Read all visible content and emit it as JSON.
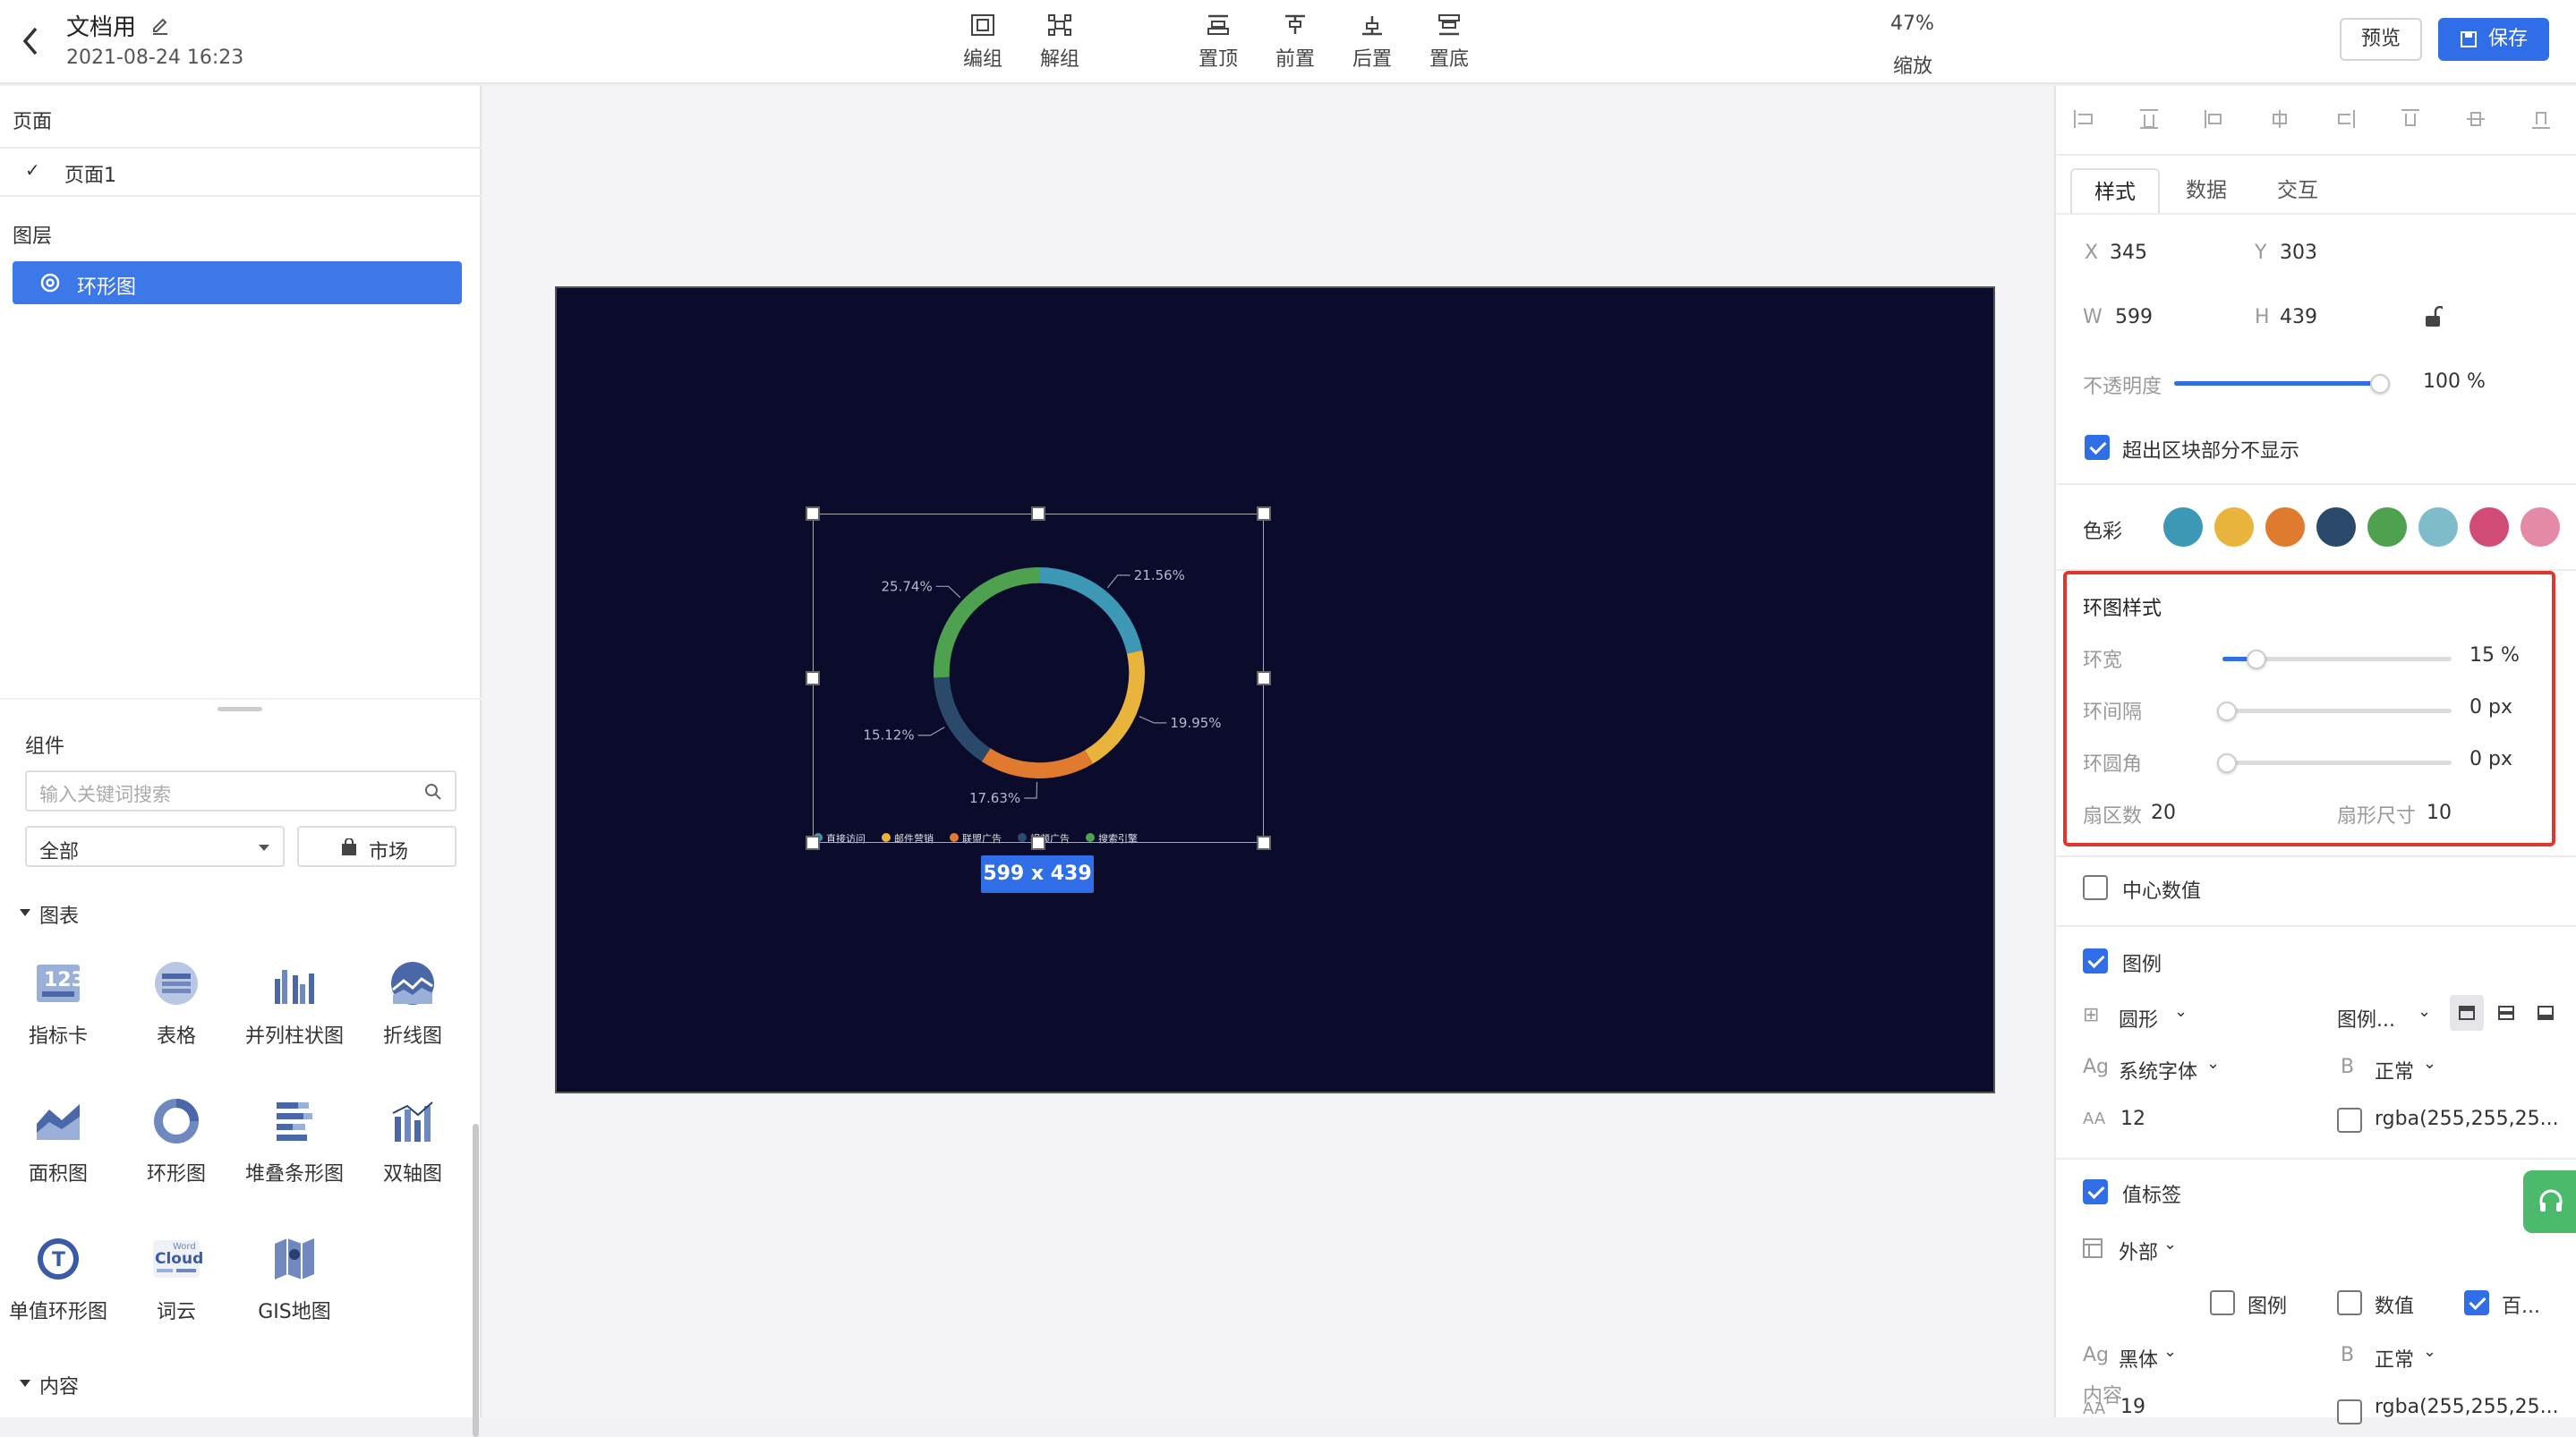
{
  "header": {
    "doc_title": "文档用",
    "timestamp": "2021-08-24 16:23",
    "tools": [
      {
        "label": "编组",
        "icon": "group-icon"
      },
      {
        "label": "解组",
        "icon": "ungroup-icon"
      },
      {
        "label": "置顶",
        "icon": "bring-to-top-icon"
      },
      {
        "label": "前置",
        "icon": "bring-forward-icon"
      },
      {
        "label": "后置",
        "icon": "send-backward-icon"
      },
      {
        "label": "置底",
        "icon": "send-to-bottom-icon"
      }
    ],
    "zoom_value": "47%",
    "zoom_label": "缩放",
    "preview_label": "预览",
    "save_label": "保存"
  },
  "left": {
    "pages_title": "页面",
    "page_item": "页面1",
    "layers_title": "图层",
    "layer_item": "环形图",
    "components_title": "组件",
    "search_placeholder": "输入关键词搜索",
    "filter_value": "全部",
    "market_label": "市场",
    "chart_group": "图表",
    "components": [
      {
        "label": "指标卡",
        "icon": "metric-card-icon"
      },
      {
        "label": "表格",
        "icon": "table-icon"
      },
      {
        "label": "并列柱状图",
        "icon": "grouped-bar-icon"
      },
      {
        "label": "折线图",
        "icon": "line-chart-icon"
      },
      {
        "label": "面积图",
        "icon": "area-chart-icon"
      },
      {
        "label": "环形图",
        "icon": "donut-chart-icon"
      },
      {
        "label": "堆叠条形图",
        "icon": "stacked-bar-icon"
      },
      {
        "label": "双轴图",
        "icon": "dual-axis-icon"
      },
      {
        "label": "单值环形图",
        "icon": "single-value-donut-icon"
      },
      {
        "label": "词云",
        "icon": "word-cloud-icon"
      },
      {
        "label": "GIS地图",
        "icon": "gis-map-icon"
      }
    ],
    "word_cloud_icon_text": {
      "small": "Word",
      "big": "Cloud"
    },
    "content_group": "内容"
  },
  "canvas": {
    "background": "#0b0b2b",
    "size_badge": "599 x 439"
  },
  "chart_data": {
    "type": "pie",
    "inner_radius_ratio": 0.85,
    "series": [
      {
        "name": "直接访问",
        "value": 21.56,
        "color": "#3d98b6"
      },
      {
        "name": "邮件营销",
        "value": 19.95,
        "color": "#e8b43c"
      },
      {
        "name": "联盟广告",
        "value": 17.63,
        "color": "#e07a2f"
      },
      {
        "name": "视频广告",
        "value": 15.12,
        "color": "#2b4a6b"
      },
      {
        "name": "搜索引擎",
        "value": 25.74,
        "color": "#4ea24f"
      }
    ],
    "value_labels": [
      "21.56%",
      "19.95%",
      "17.63%",
      "15.12%",
      "25.74%"
    ],
    "legend_position": "bottom-left"
  },
  "right": {
    "align_icons": [
      "align-left-icon",
      "align-hcenter-icon",
      "align-right-icon",
      "distribute-h-icon",
      "align-top-icon",
      "align-vcenter-icon",
      "align-bottom-icon",
      "distribute-v-icon"
    ],
    "tabs": [
      "样式",
      "数据",
      "交互"
    ],
    "x_label": "X",
    "x_value": "345",
    "y_label": "Y",
    "y_value": "303",
    "w_label": "W",
    "w_value": "599",
    "h_label": "H",
    "h_value": "439",
    "opacity_label": "不透明度",
    "opacity_value": "100 %",
    "opacity_fraction": 1.0,
    "clip_label": "超出区块部分不显示",
    "color_label": "色彩",
    "palette": [
      "#3d98b6",
      "#e8b43c",
      "#e07a2f",
      "#2b4a6b",
      "#4ea24f",
      "#7fbcca",
      "#d24a76",
      "#e58aa6"
    ],
    "ring_section_title": "环图样式",
    "ring_width_label": "环宽",
    "ring_width_value": "15 %",
    "ring_width_fraction": 0.15,
    "ring_gap_label": "环间隔",
    "ring_gap_value": "0 px",
    "ring_radius_label": "环圆角",
    "ring_radius_value": "0 px",
    "sector_count_label": "扇区数",
    "sector_count_value": "20",
    "sector_size_label": "扇形尺寸",
    "sector_size_value": "10",
    "center_value_label": "中心数值",
    "legend_label": "图例",
    "legend_shape": "圆形",
    "legend_pos": "图例...",
    "font_icon": "Ag",
    "font_family": "系统字体",
    "bold_icon": "B",
    "font_weight": "正常",
    "size_icon": "AA",
    "font_size": "12",
    "legend_color": "rgba(255,255,25...",
    "value_label_title": "值标签",
    "value_label_pos": "外部",
    "content_label": "内容",
    "content_opt1": "图例",
    "content_opt2": "数值",
    "content_opt3": "百...",
    "vl_font_family": "黑体",
    "vl_font_weight": "正常",
    "vl_font_size": "19",
    "vl_color": "rgba(255,255,25..."
  }
}
